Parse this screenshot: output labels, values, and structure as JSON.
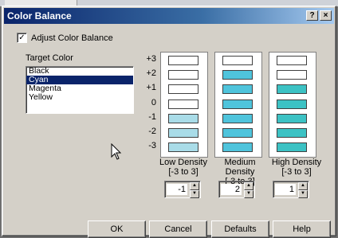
{
  "window": {
    "title": "Color Balance",
    "help_glyph": "?",
    "close_glyph": "×"
  },
  "adjust": {
    "label": "Adjust Color Balance",
    "checked": true,
    "checkmark": "✓"
  },
  "target": {
    "label": "Target Color",
    "items": [
      "Black",
      "Cyan",
      "Magenta",
      "Yellow"
    ],
    "selected": "Cyan"
  },
  "levels": [
    "+3",
    "+2",
    "+1",
    "0",
    "-1",
    "-2",
    "-3"
  ],
  "columns": [
    {
      "title": "Low Density",
      "range": "[-3 to 3]",
      "value": "-1"
    },
    {
      "title": "Medium Density",
      "range": "[-3 to 3]",
      "value": "2"
    },
    {
      "title": "High Density",
      "range": "[-3 to 3]",
      "value": "1"
    }
  ],
  "colors": {
    "empty": "#ffffff",
    "low": "#a9dce8",
    "medium": "#4fc4dc",
    "high": "#3cc2c4"
  },
  "buttons": {
    "ok": "OK",
    "cancel": "Cancel",
    "defaults": "Defaults",
    "help": "Help"
  }
}
